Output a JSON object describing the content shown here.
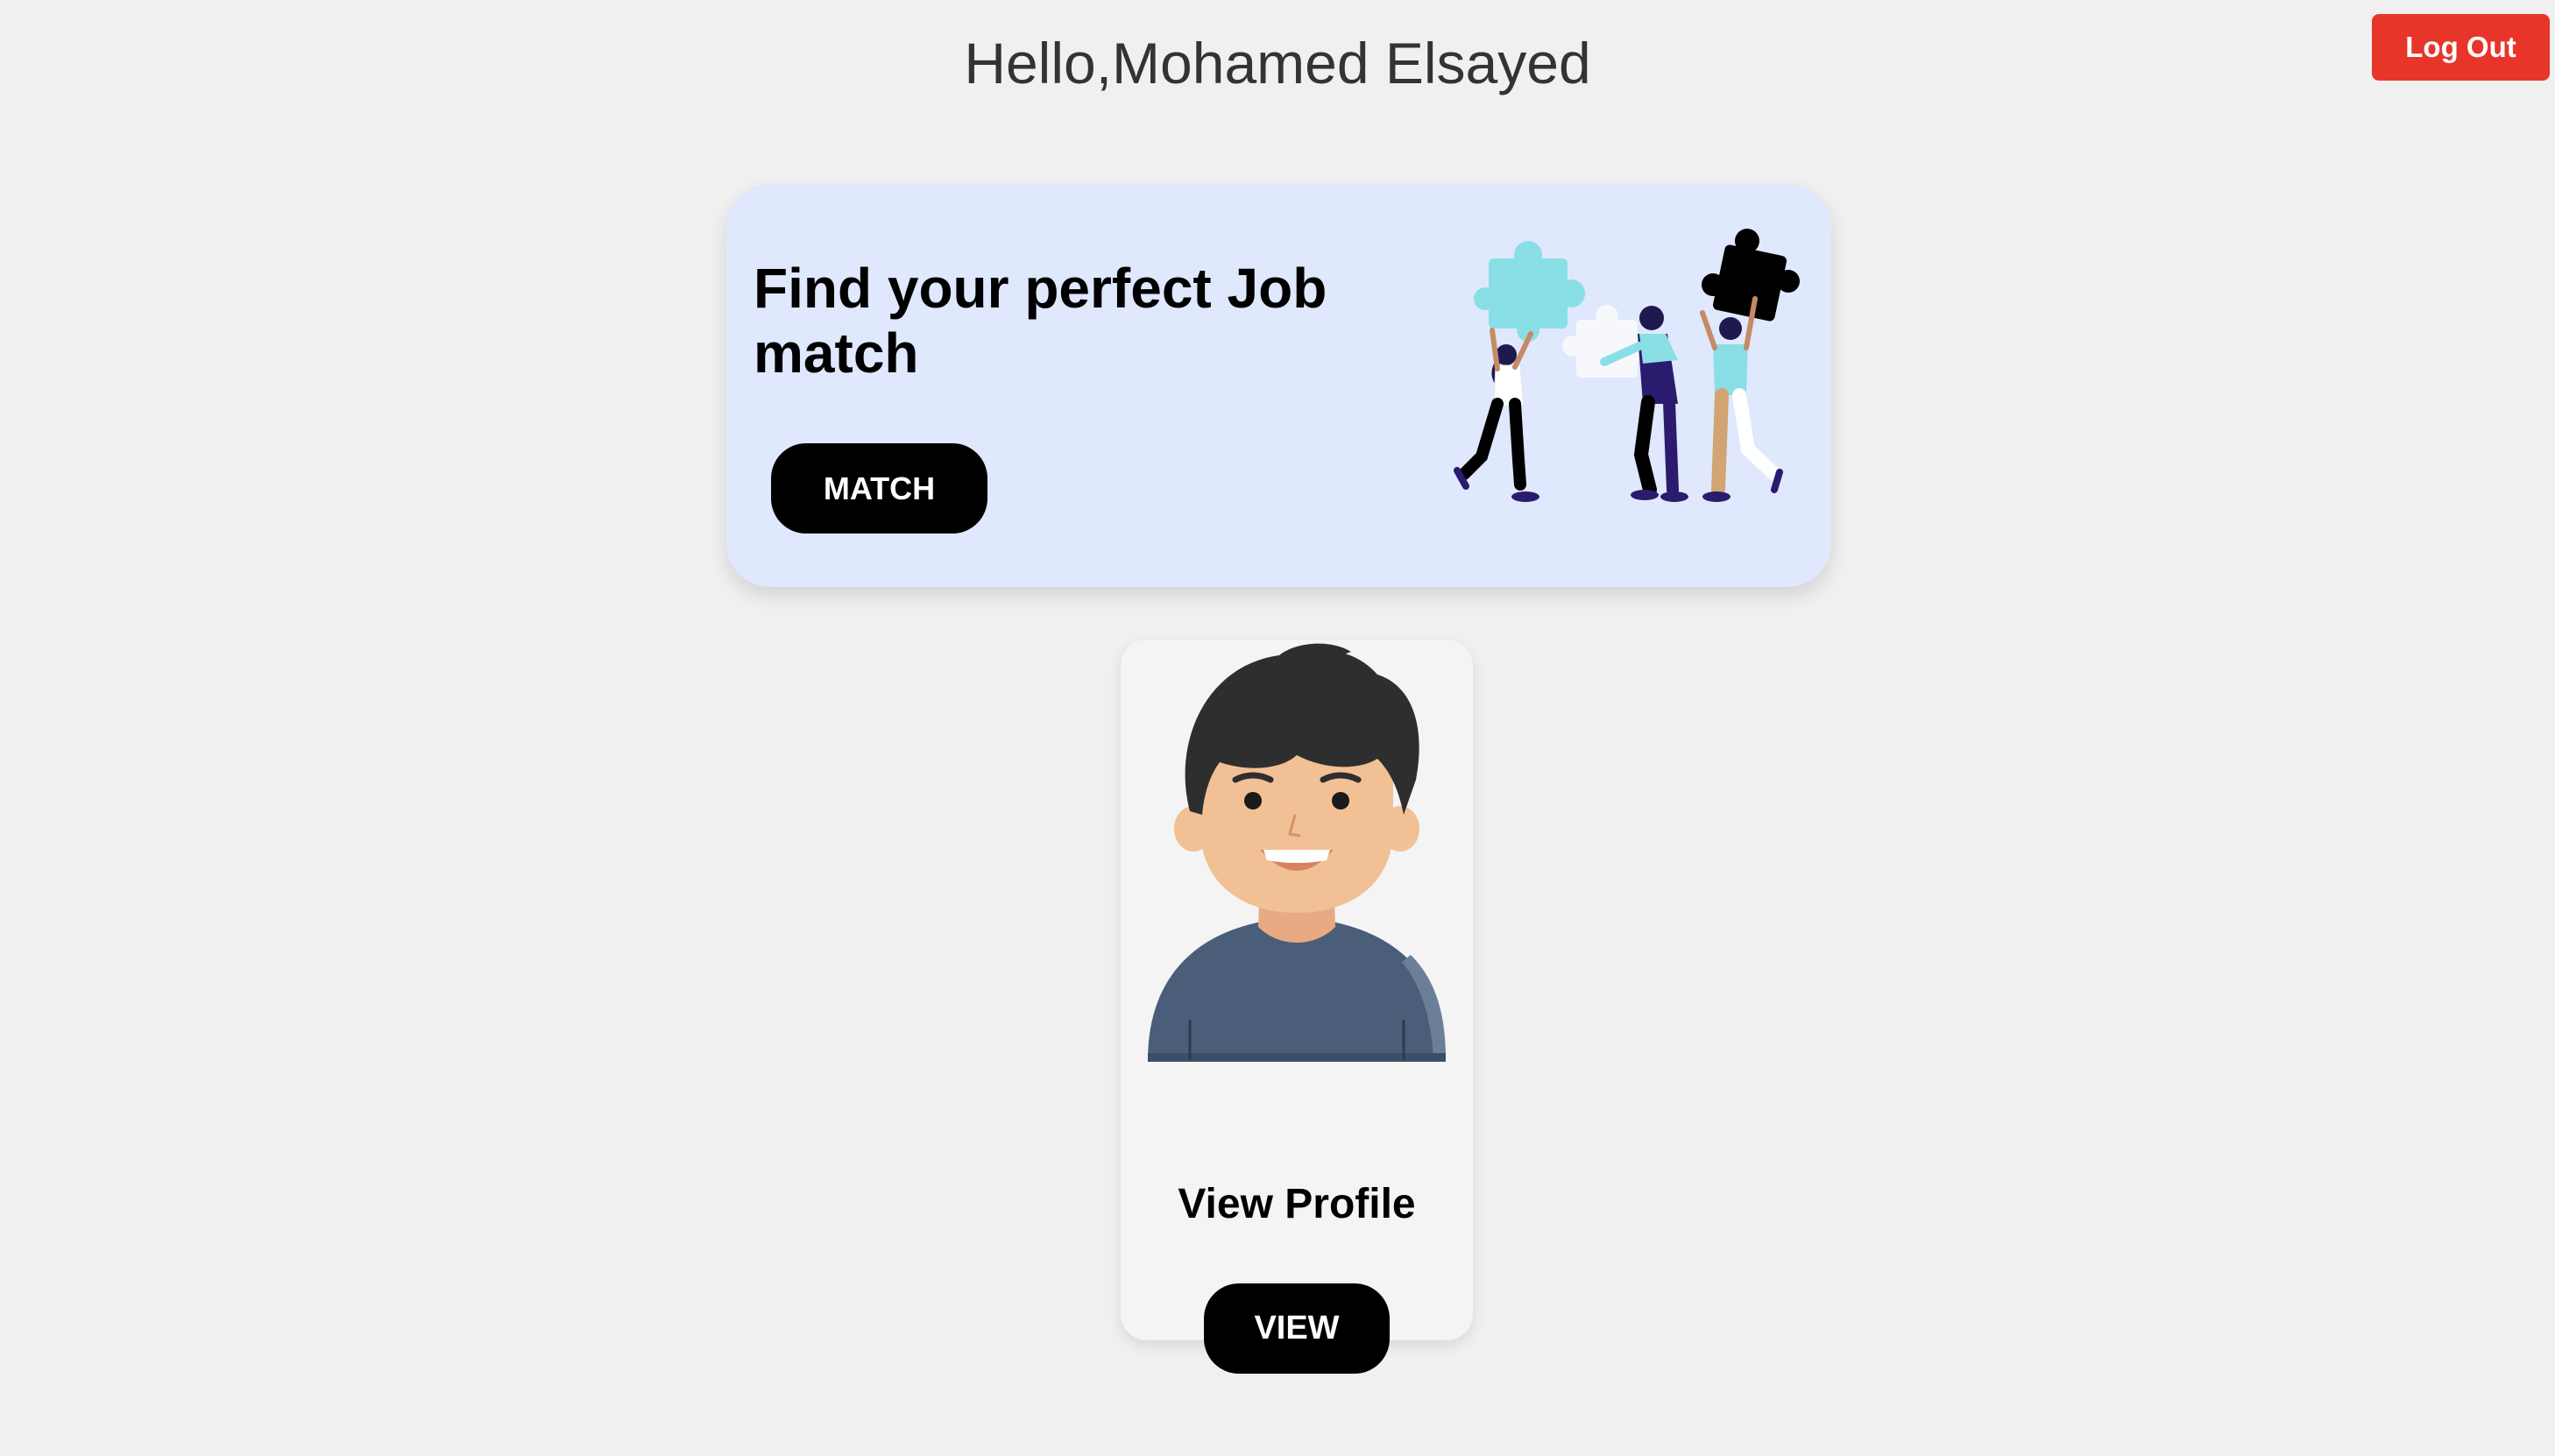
{
  "header": {
    "greeting": "Hello,Mohamed Elsayed",
    "logout_label": "Log Out"
  },
  "match_card": {
    "title": "Find your perfect Job match",
    "button_label": "MATCH",
    "illustration_icon": "people-puzzle-illustration"
  },
  "profile_card": {
    "avatar_icon": "user-avatar-illustration",
    "title": "View Profile",
    "button_label": "VIEW"
  },
  "colors": {
    "background": "#f0f0f0",
    "logout": "#e8352a",
    "match_card_bg": "#dfe8fc",
    "button": "#000000"
  }
}
